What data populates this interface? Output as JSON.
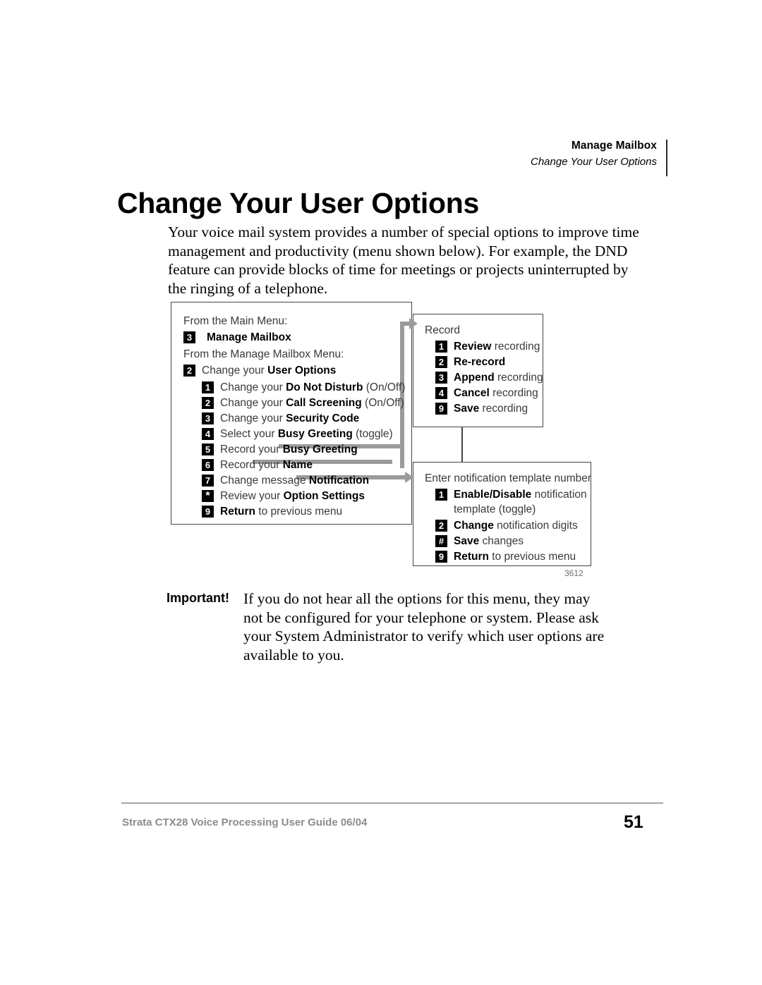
{
  "header": {
    "title": "Manage Mailbox",
    "subtitle": "Change Your User Options"
  },
  "page_title": "Change Your User Options",
  "intro": "Your voice mail system provides a number of special options to improve time management and productivity (menu shown below). For example, the DND feature can provide blocks of time for meetings or projects uninterrupted by the ringing of a telephone.",
  "diagram": {
    "figure_number": "3612",
    "left_panel": {
      "lead_1": "From the Main Menu:",
      "lead_2": "From the Manage Mailbox Menu:",
      "main_menu_item": {
        "key": "3",
        "pre": "",
        "bold": "Manage Mailbox",
        "post": ""
      },
      "mailbox_item": {
        "key": "2",
        "pre": "Change your ",
        "bold": "User Options",
        "post": ""
      },
      "options": [
        {
          "key": "1",
          "pre": "Change your ",
          "bold": "Do Not Disturb",
          "post": "  (On/Off)"
        },
        {
          "key": "2",
          "pre": "Change your ",
          "bold": "Call Screening",
          "post": " (On/Off)"
        },
        {
          "key": "3",
          "pre": "Change your ",
          "bold": "Security Code",
          "post": ""
        },
        {
          "key": "4",
          "pre": "Select your ",
          "bold": "Busy Greeting",
          "post": " (toggle)"
        },
        {
          "key": "5",
          "pre": "Record your ",
          "bold": "Busy Greeting",
          "post": ""
        },
        {
          "key": "6",
          "pre": "Record your ",
          "bold": "Name",
          "post": ""
        },
        {
          "key": "7",
          "pre": "Change message ",
          "bold": "Notification",
          "post": ""
        },
        {
          "key": "*",
          "pre": "Review your ",
          "bold": "Option Settings",
          "post": ""
        },
        {
          "key": "9",
          "pre": "",
          "bold": "Return",
          "post": " to previous menu"
        }
      ]
    },
    "record_panel": {
      "heading": "Record",
      "items": [
        {
          "key": "1",
          "pre": "",
          "bold": "Review",
          "post": " recording"
        },
        {
          "key": "2",
          "pre": "",
          "bold": "Re-record",
          "post": ""
        },
        {
          "key": "3",
          "pre": "",
          "bold": "Append",
          "post": " recording"
        },
        {
          "key": "4",
          "pre": "",
          "bold": "Cancel",
          "post": " recording"
        },
        {
          "key": "9",
          "pre": "",
          "bold": "Save",
          "post": " recording"
        }
      ]
    },
    "notify_panel": {
      "heading": "Enter notification template number",
      "items": [
        {
          "key": "1",
          "pre": "",
          "bold": "Enable/Disable",
          "post": " notification",
          "line2": "template (toggle)"
        },
        {
          "key": "2",
          "pre": "",
          "bold": "Change",
          "post": " notification digits",
          "line2": ""
        },
        {
          "key": "#",
          "pre": "",
          "bold": "Save",
          "post": " changes",
          "line2": ""
        },
        {
          "key": "9",
          "pre": "",
          "bold": "Return",
          "post": " to previous menu",
          "line2": ""
        }
      ]
    }
  },
  "important": {
    "label": "Important!",
    "body": "If you do not hear all the options for this menu, they may not be configured for your telephone or system. Please ask your System Administrator to verify which user options are available to you."
  },
  "footer": {
    "guide": "Strata CTX28 Voice Processing User Guide   06/04",
    "page_number": "51"
  }
}
